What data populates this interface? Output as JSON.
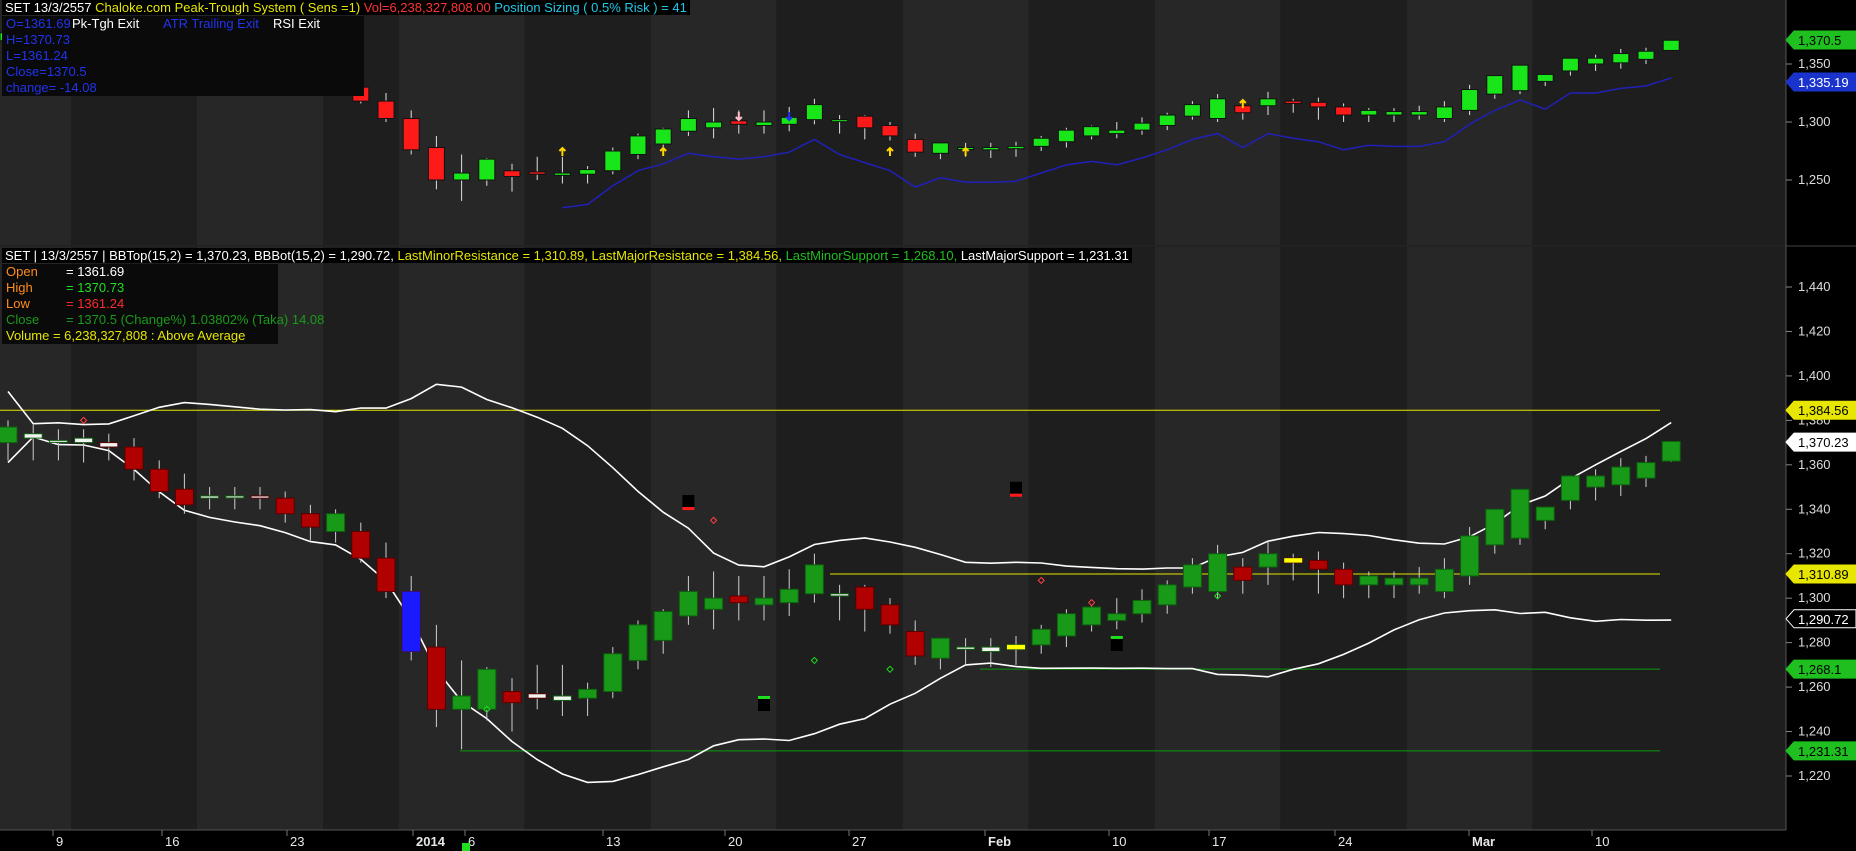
{
  "colors": {
    "bg": "#000000",
    "plot_bg": "#1e1e1e",
    "band_alt": "#272727",
    "up_top": "#19e619",
    "down_top": "#ff1a1a",
    "up_bottom": "#189a18",
    "down_bottom": "#b00000",
    "trail": "#2020b8",
    "bands": "#ffffff",
    "resistance": "#e6e600",
    "support": "#0a9a0a",
    "axis_text": "#dcdcdc"
  },
  "top_panel": {
    "header": {
      "symbol_date": "SET 13/3/2557",
      "system": "Chaloke.com Peak-Trough System ( Sens =1)",
      "volume": "Vol=6,238,327,808.00",
      "sizing": "Position Sizing ( 0.5% Risk ) = 41"
    },
    "ohlc": {
      "open": "O=1361.69",
      "high": "H=1370.73",
      "low": "L=1361.24",
      "close": "Close=1370.5",
      "change": "change= -14.08"
    },
    "exits": {
      "pk": "Pk-Tgh Exit",
      "atr": "ATR Trailing Exit",
      "rsi": "RSI Exit"
    },
    "price_badges": [
      "1,370.5",
      "1,335.19"
    ],
    "y_ticks": [
      "1,350",
      "1,300",
      "1,250"
    ]
  },
  "bottom_panel": {
    "header": {
      "prefix": "SET | 13/3/2557 | BBTop(15,2) = 1,370.23, BBBot(15,2) = 1,290.72,",
      "minor_res": "LastMinorResistance = 1,310.89,",
      "major_res": "LastMajorResistance = 1,384.56,",
      "minor_sup": "LastMinorSupport = 1,268.10,",
      "major_sup": "LastMajorSupport = 1,231.31"
    },
    "info": {
      "open_label": "Open",
      "open_value": "= 1361.69",
      "high_label": "High",
      "high_value": "= 1370.73",
      "low_label": "Low",
      "low_value": "= 1361.24",
      "close_label": "Close",
      "close_value": "= 1370.5  (Change%)  1.03802%  (Taka)  14.08",
      "volume_text": "Volume  = 6,238,327,808 : Above Average"
    },
    "y_ticks": [
      "1,440",
      "1,420",
      "1,400",
      "1,380",
      "1,360",
      "1,340",
      "1,320",
      "1,300",
      "1,280",
      "1,260",
      "1,240",
      "1,220"
    ],
    "price_badges": [
      "1,384.56",
      "1,370.23",
      "1,310.89",
      "1,290.72",
      "1,268.1",
      "1,231.31"
    ]
  },
  "x_labels": [
    "9",
    "16",
    "23",
    "2014",
    "6",
    "13",
    "20",
    "27",
    "Feb",
    "10",
    "17",
    "24",
    "Mar",
    "10"
  ],
  "chart_data": {
    "type": "candlestick",
    "title": "SET 13/3/2557",
    "series": [
      {
        "name": "OHLC",
        "ohlc": [
          [
            1370,
            1380,
            1362,
            1377
          ],
          [
            1372,
            1378,
            1362,
            1374
          ],
          [
            1371,
            1376,
            1362,
            1371
          ],
          [
            1370,
            1376,
            1361,
            1372
          ],
          [
            1370,
            1374,
            1362,
            1368
          ],
          [
            1368,
            1372,
            1353,
            1358
          ],
          [
            1358,
            1362,
            1345,
            1348
          ],
          [
            1349,
            1356,
            1338,
            1342
          ],
          [
            1345,
            1350,
            1340,
            1346
          ],
          [
            1346,
            1350,
            1340,
            1346
          ],
          [
            1346,
            1350,
            1340,
            1345
          ],
          [
            1345,
            1348,
            1334,
            1338
          ],
          [
            1338,
            1342,
            1326,
            1332
          ],
          [
            1330,
            1340,
            1325,
            1338
          ],
          [
            1330,
            1334,
            1316,
            1318
          ],
          [
            1318,
            1325,
            1300,
            1303
          ],
          [
            1303,
            1310,
            1272,
            1276
          ],
          [
            1278,
            1288,
            1242,
            1250
          ],
          [
            1250,
            1272,
            1232,
            1256
          ],
          [
            1250,
            1269,
            1245,
            1268
          ],
          [
            1258,
            1264,
            1240,
            1253
          ],
          [
            1257,
            1270,
            1250,
            1255
          ],
          [
            1254,
            1270,
            1247,
            1256
          ],
          [
            1255,
            1262,
            1247,
            1259
          ],
          [
            1258,
            1278,
            1255,
            1275
          ],
          [
            1272,
            1290,
            1268,
            1288
          ],
          [
            1281,
            1295,
            1275,
            1294
          ],
          [
            1292,
            1310,
            1288,
            1303
          ],
          [
            1295,
            1312,
            1286,
            1300
          ],
          [
            1301,
            1310,
            1290,
            1298
          ],
          [
            1297,
            1310,
            1290,
            1300
          ],
          [
            1298,
            1313,
            1292,
            1304
          ],
          [
            1302,
            1320,
            1298,
            1315
          ],
          [
            1301,
            1306,
            1290,
            1302
          ],
          [
            1305,
            1306,
            1285,
            1295
          ],
          [
            1297,
            1300,
            1284,
            1288
          ],
          [
            1285,
            1290,
            1270,
            1274
          ],
          [
            1273,
            1282,
            1268,
            1282
          ],
          [
            1277,
            1282,
            1270,
            1278
          ],
          [
            1276,
            1282,
            1269,
            1278
          ],
          [
            1277,
            1283,
            1270,
            1279
          ],
          [
            1279,
            1288,
            1275,
            1286
          ],
          [
            1283,
            1295,
            1278,
            1293
          ],
          [
            1288,
            1297,
            1285,
            1296
          ],
          [
            1290,
            1300,
            1286,
            1293
          ],
          [
            1293,
            1304,
            1289,
            1299
          ],
          [
            1297,
            1308,
            1293,
            1306
          ],
          [
            1305,
            1318,
            1302,
            1315
          ],
          [
            1303,
            1324,
            1300,
            1320
          ],
          [
            1314,
            1318,
            1302,
            1308
          ],
          [
            1314,
            1326,
            1306,
            1320
          ],
          [
            1318,
            1320,
            1308,
            1316
          ],
          [
            1317,
            1321,
            1302,
            1313
          ],
          [
            1313,
            1316,
            1300,
            1306
          ],
          [
            1306,
            1312,
            1300,
            1310
          ],
          [
            1306,
            1312,
            1300,
            1309
          ],
          [
            1306,
            1314,
            1302,
            1309
          ],
          [
            1303,
            1318,
            1300,
            1313
          ],
          [
            1310,
            1332,
            1306,
            1328
          ],
          [
            1324,
            1338,
            1320,
            1340
          ],
          [
            1327,
            1346,
            1324,
            1349
          ],
          [
            1335,
            1341,
            1331,
            1341
          ],
          [
            1344,
            1350,
            1340,
            1355
          ],
          [
            1350,
            1358,
            1344,
            1355
          ],
          [
            1351,
            1363,
            1346,
            1359
          ],
          [
            1354,
            1364,
            1350,
            1361
          ],
          [
            1361.69,
            1370.73,
            1361.24,
            1370.5
          ]
        ]
      },
      {
        "name": "BBTop(15,2)",
        "note": "upper band"
      },
      {
        "name": "BBBot(15,2)",
        "note": "lower band"
      }
    ],
    "levels": {
      "LastMajorResistance": 1384.56,
      "LastMinorResistance": 1310.89,
      "LastMinorSupport": 1268.1,
      "LastMajorSupport": 1231.31
    },
    "bbtop_last": 1370.23,
    "bbbot_last": 1290.72,
    "ylim_bottom": [
      1210,
      1450
    ],
    "ylim_top": [
      1205,
      1380
    ]
  }
}
